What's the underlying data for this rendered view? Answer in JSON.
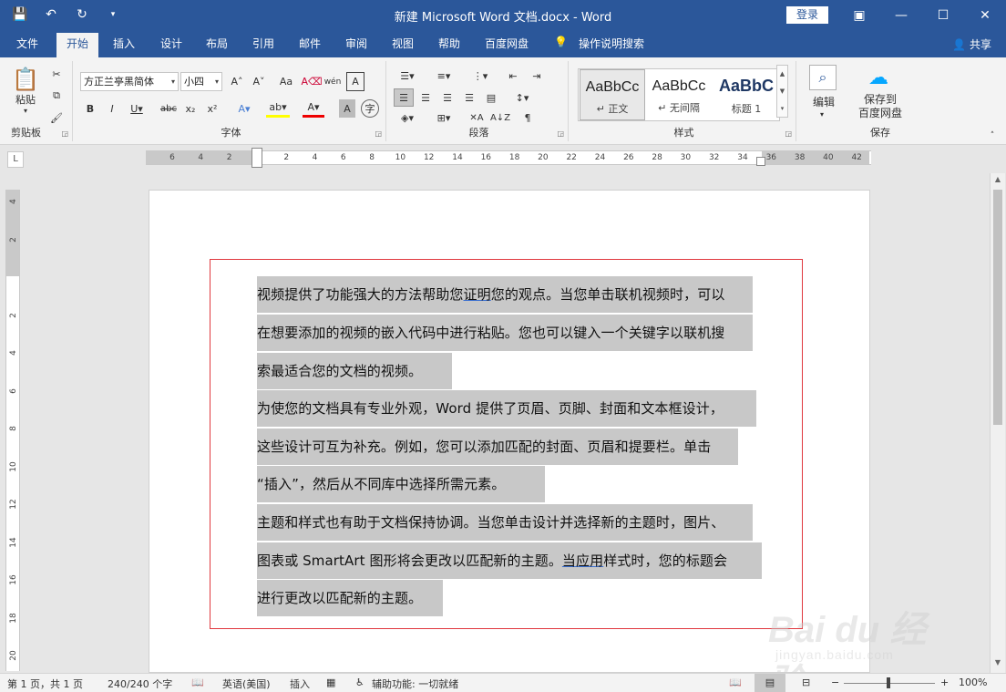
{
  "window": {
    "title": "新建 Microsoft Word 文档.docx  -  Word",
    "login_label": "登录"
  },
  "tabs": [
    "文件",
    "开始",
    "插入",
    "设计",
    "布局",
    "引用",
    "邮件",
    "审阅",
    "视图",
    "帮助",
    "百度网盘"
  ],
  "active_tab": "开始",
  "tell_me": "操作说明搜索",
  "share_label": "共享",
  "ribbon": {
    "clipboard": {
      "label": "剪贴板",
      "paste": "粘贴"
    },
    "font": {
      "label": "字体",
      "font_name": "方正兰亭黑简体",
      "font_size": "小四"
    },
    "paragraph": {
      "label": "段落"
    },
    "styles": {
      "label": "样式",
      "items": [
        {
          "sample": "AaBbCc",
          "name": "↵ 正文"
        },
        {
          "sample": "AaBbCc",
          "name": "↵ 无间隔"
        },
        {
          "sample": "AaBbC",
          "name": "标题 1"
        }
      ]
    },
    "editing": {
      "label": "编辑"
    },
    "save": {
      "label": "保存",
      "button": "保存到\n百度网盘"
    }
  },
  "ruler_ticks": [
    "6",
    "4",
    "2",
    "",
    "2",
    "4",
    "6",
    "8",
    "10",
    "12",
    "14",
    "16",
    "18",
    "20",
    "22",
    "24",
    "26",
    "28",
    "30",
    "32",
    "34",
    "36",
    "38",
    "40",
    "42"
  ],
  "vruler_ticks": [
    "4",
    "2",
    "",
    "2",
    "4",
    "6",
    "8",
    "10",
    "12",
    "14",
    "16",
    "18",
    "20"
  ],
  "document": {
    "lines": [
      "视频提供了功能强大的方法帮助您证明您的观点。当您单击联机视频时，可以",
      "在想要添加的视频的嵌入代码中进行粘贴。您也可以键入一个关键字以联机搜",
      "索最适合您的文档的视频。",
      "为使您的文档具有专业外观，Word 提供了页眉、页脚、封面和文本框设计，",
      "这些设计可互为补充。例如，您可以添加匹配的封面、页眉和提要栏。单击",
      "“插入”，然后从不同库中选择所需元素。",
      "主题和样式也有助于文档保持协调。当您单击设计并选择新的主题时，图片、",
      "图表或 SmartArt 图形将会更改以匹配新的主题。当应用样式时，您的标题会",
      "进行更改以匹配新的主题。"
    ]
  },
  "statusbar": {
    "page": "第 1 页，共 1 页",
    "words": "240/240 个字",
    "language": "英语(美国)",
    "mode": "插入",
    "accessibility": "辅助功能: 一切就绪",
    "zoom": "100%"
  },
  "watermark": {
    "brand": "Bai du 经验",
    "url": "jingyan.baidu.com"
  },
  "colors": {
    "accent": "#2b579a",
    "frame": "#e0383e",
    "highlight": "#c8c8c8"
  }
}
